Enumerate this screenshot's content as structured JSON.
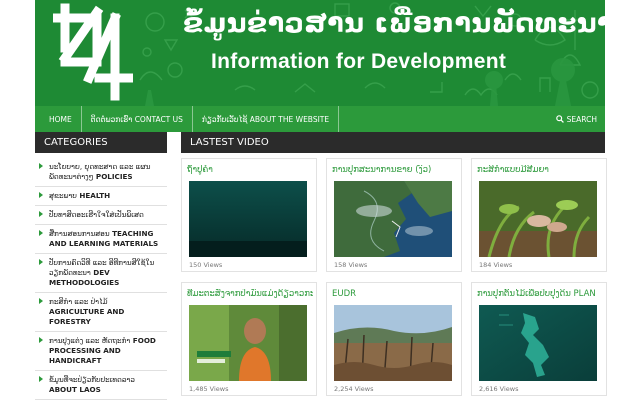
{
  "header": {
    "title_lao": "ຂໍ້ມູນຂ່າວສານ ເພື່ອການພັດທະນາ",
    "title_en": "Information for Development",
    "logo": "i4d-logo"
  },
  "nav": {
    "items": [
      {
        "label": "HOME"
      },
      {
        "label": "ຕິດຕໍ່ພວກເຮົາ CONTACT US"
      },
      {
        "label": "ກ່ຽວກັບເວັບໄຊ້ ABOUT THE WEBSITE"
      }
    ],
    "search_label": "SEARCH",
    "search_icon": "search-icon"
  },
  "sidebar": {
    "heading": "CATEGORIES",
    "items": [
      {
        "lao": "ນະໂຍບາຍ, ຍຸດທະສາດ ແລະ ແຜນພັດທະນາຕ່າງໆ",
        "en": "POLICIES"
      },
      {
        "lao": "ສຸຂະພາບ",
        "en": "HEALTH"
      },
      {
        "lao": "ປັບທາສິດອະເຮີາໃຈໃສ່ເປັນພິເສດ",
        "en": ""
      },
      {
        "lao": "ສື່ການສອນການສອນ",
        "en": "TEACHING AND LEARNING MATERIALS"
      },
      {
        "lao": "ປັບການຄົດວິທີ ແລະ ອີທີການສີໃຊ້ໃນວຽກພັດທະນາ",
        "en": "DEV METHODOLOGIES"
      },
      {
        "lao": "ກະສິກຳ ແລະ ປ່າໄມ້",
        "en": "AGRICULTURE AND FORESTRY"
      },
      {
        "lao": "ການປຸງແຕ່ງ ແລະ ຫັດຖະກຳ",
        "en": "FOOD PROCESSING AND HANDICRAFT"
      },
      {
        "lao": "ຂໍ້ມູນທີ່ຈະປ່ຽວກັບປະເທດລາວ",
        "en": "ABOUT LAOS"
      }
    ]
  },
  "videos": {
    "heading": "LASTEST VIDEO",
    "items": [
      {
        "title": "ຖ້ຳປູຄຳ",
        "views": "150 Views",
        "thumb": "dark-teal"
      },
      {
        "title": "ການປຸກສະນາການຂາຍ (ງົວ)",
        "views": "158 Views",
        "thumb": "satellite-map"
      },
      {
        "title": "ກະສິກຳແບບມີສີມຍາ",
        "views": "184 Views",
        "thumb": "plants"
      },
      {
        "title": "ທີ່ມະຕະສົ່ງຈາກປ່າມົ່ນແມ່ງດ້ຽວາວກະ",
        "views": "1,485 Views",
        "thumb": "man-forest"
      },
      {
        "title": "EUDR",
        "views": "2,254 Views",
        "thumb": "deforested"
      },
      {
        "title": "ການປຸກຕົ້ນໄມ້ເພື່ອປັບປຸງດິນ PLAN",
        "views": "2,616 Views",
        "thumb": "laos-map"
      }
    ]
  },
  "colors": {
    "banner_green": "#1e8a34",
    "nav_green": "#2c9a3b",
    "dark_bar": "#2b2b2b",
    "link_green": "#2c9a3b"
  }
}
